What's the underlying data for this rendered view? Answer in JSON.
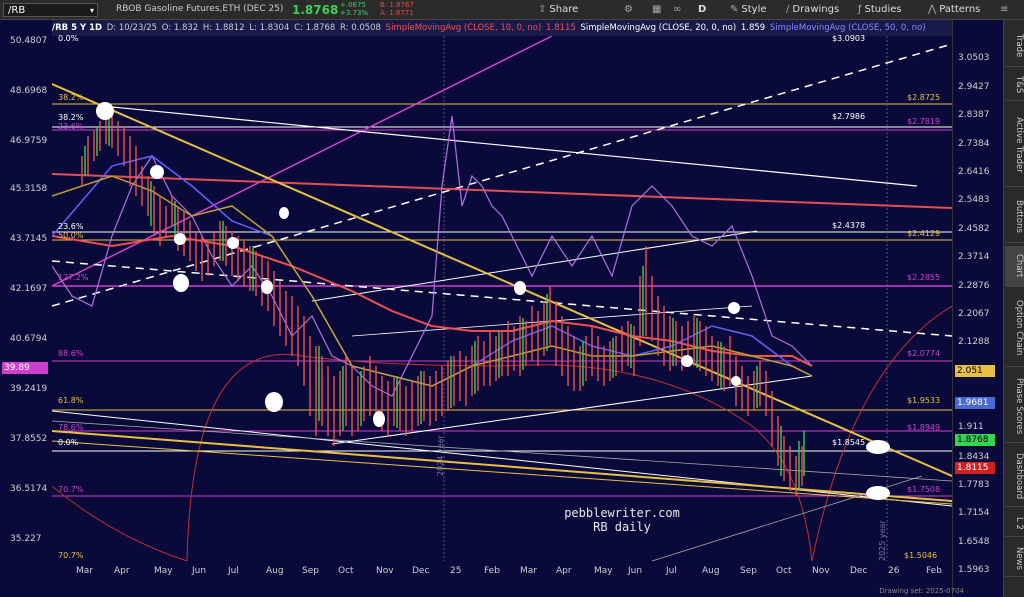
{
  "header": {
    "symbol": "/RB",
    "instrument": "RBOB Gasoline Futures,ETH (DEC 25)",
    "last_price": "1.8768",
    "change_abs": "+.0675",
    "change_pct": "+3.73%",
    "bid": "B: 1.8767",
    "ask": "A: 1.8771",
    "toolbar": {
      "share": "Share",
      "period": "D",
      "style": "Style",
      "drawings": "Drawings",
      "studies": "Studies",
      "patterns": "Patterns"
    }
  },
  "studies_bar": {
    "title": "/RB 5 Y 1D",
    "date": "D: 10/23/25",
    "open": "O: 1.832",
    "high": "H: 1.8812",
    "low": "L: 1.8304",
    "close": "C: 1.8768",
    "range": "R: 0.0508",
    "sma10": "SimpleMovingAvg (CLOSE, 10, 0, no)",
    "sma10_val": "1.8115",
    "sma20": "SimpleMovingAvg (CLOSE, 20, 0, no)",
    "sma20_val": "1.859",
    "sma50": "SimpleMovingAvg (CLOSE, 50, 0, no)"
  },
  "left_axis": [
    "50.4807",
    "48.6968",
    "46.9759",
    "45.3158",
    "43.7145",
    "42.1697",
    "40.6794",
    "39.2419",
    "37.8552",
    "36.5174",
    "35.227"
  ],
  "left_axis_label": "39.89",
  "right_axis": [
    "3.0503",
    "2.9427",
    "2.8387",
    "2.7384",
    "2.6416",
    "2.5483",
    "2.4582",
    "2.3714",
    "2.2876",
    "2.2067",
    "2.1288",
    "1.911",
    "1.8434",
    "1.7783",
    "1.7154",
    "1.6548",
    "1.5963"
  ],
  "price_labels": {
    "sma50": "2.051",
    "level1": "1.9681",
    "last": "1.8768",
    "sma10": "1.8115"
  },
  "x_axis": [
    "Mar",
    "Apr",
    "May",
    "Jun",
    "Jul",
    "Aug",
    "Sep",
    "Oct",
    "Nov",
    "Dec",
    "25",
    "Feb",
    "Mar",
    "Apr",
    "May",
    "Jun",
    "Jul",
    "Aug",
    "Sep",
    "Oct",
    "Nov",
    "Dec",
    "26",
    "Feb"
  ],
  "fib_left": {
    "f0": "0.0%",
    "f382": "38.2%",
    "f236": "23.6%",
    "f500": "50.0%",
    "f618": "61.8%",
    "f786": "78.6%",
    "f886": "88.6%",
    "f00b": "0.0%",
    "f707": "70.7%",
    "f382b": "38.2%",
    "f236b": "23.6%",
    "f1272": "127.2%",
    "f707b": "70.7%"
  },
  "levels": {
    "l30903": "$3.0903",
    "l28725": "$2.8725",
    "l27986": "$2.7986",
    "l27819": "$2.7819",
    "l24378": "$2.4378",
    "l24129": "$2.4129",
    "l22855": "$2.2855",
    "l20774": "$2.0774",
    "l19533": "$1.9533",
    "l18949": "$1.8949",
    "l18545": "$1.8545",
    "l17508": "$1.7508",
    "l15046": "$1.5046"
  },
  "year_labels": {
    "y2024": "2024 year",
    "y2025": "2025 year"
  },
  "watermark": {
    "line1": "pebblewriter.com",
    "line2": "RB daily"
  },
  "footer": "Drawing set: 2025-0704",
  "sidebar_tabs": [
    "Trade",
    "T&S",
    "Active Trader",
    "Buttons",
    "Chart",
    "Option Chain",
    "Phase Scores",
    "Dashboard",
    "L 2",
    "News"
  ],
  "colors": {
    "background": "#0a0a3a",
    "up_candle": "#39d353",
    "down_candle": "#f05050",
    "fib_gold": "#e8c040",
    "fib_magenta": "#d040d0",
    "trend_white": "#ffffff",
    "sma_red": "#f05050",
    "sma_blue": "#6060ff"
  },
  "icons": {
    "share": "share-icon",
    "style": "style-icon",
    "drawings": "drawings-icon",
    "studies": "studies-icon",
    "patterns": "patterns-icon"
  }
}
